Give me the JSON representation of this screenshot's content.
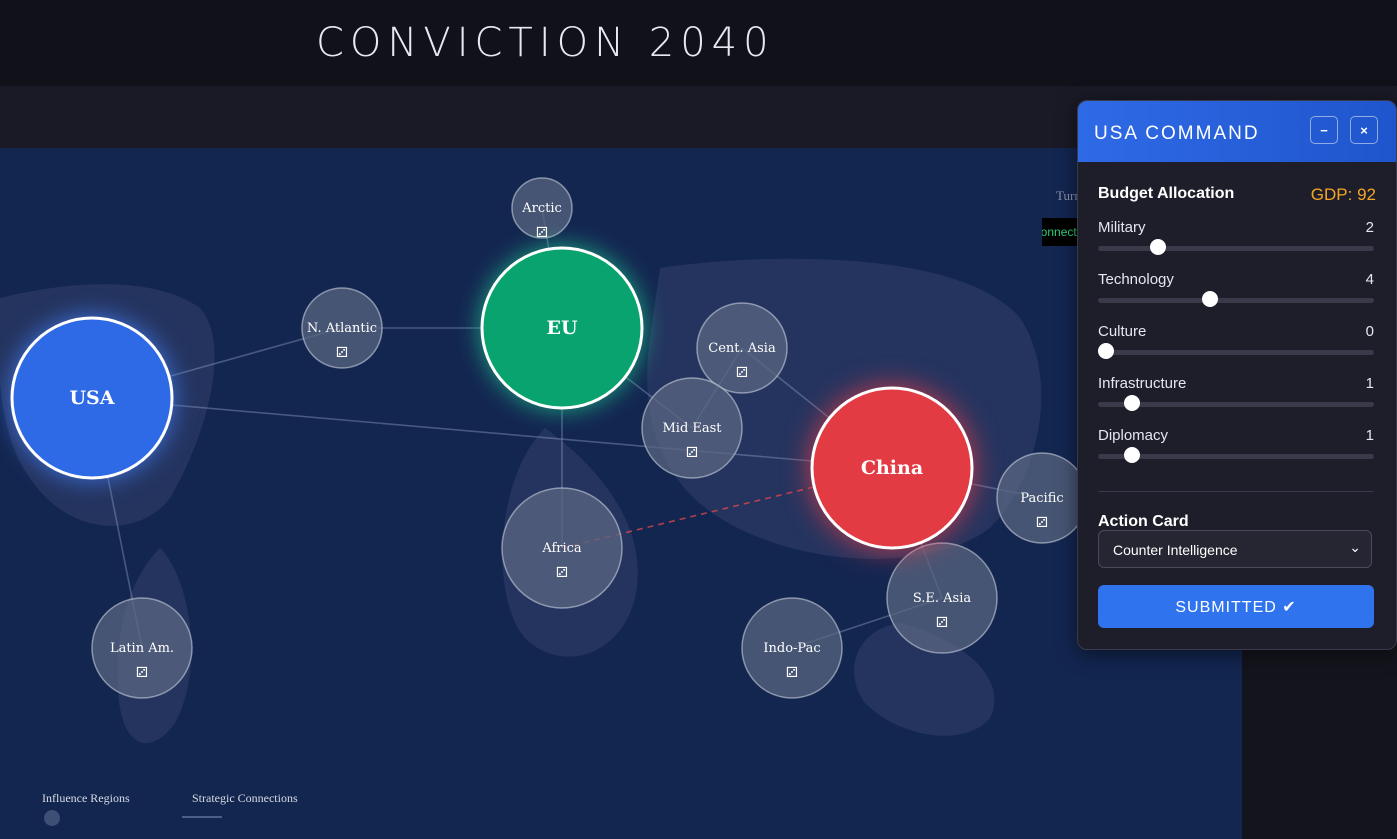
{
  "app": {
    "title": "CONVICTION 2040"
  },
  "map": {
    "turn_label": "Turn",
    "connection_status": "Connected",
    "nodes": [
      {
        "id": "usa",
        "label": "USA",
        "type": "power",
        "color": "#2f6ae6"
      },
      {
        "id": "eu",
        "label": "EU",
        "type": "power",
        "color": "#08a36e"
      },
      {
        "id": "china",
        "label": "China",
        "type": "power",
        "color": "#e23b44"
      },
      {
        "id": "arctic",
        "label": "Arctic",
        "type": "region",
        "icon": "die-icon",
        "glyph": "⚂"
      },
      {
        "id": "natlantic",
        "label": "N. Atlantic",
        "type": "region",
        "icon": "die-icon",
        "glyph": "⚂"
      },
      {
        "id": "centasia",
        "label": "Cent. Asia",
        "type": "region",
        "icon": "die-icon",
        "glyph": "⚂"
      },
      {
        "id": "mideast",
        "label": "Mid East",
        "type": "region",
        "icon": "die-icon",
        "glyph": "⚂"
      },
      {
        "id": "africa",
        "label": "Africa",
        "type": "region",
        "icon": "die-icon",
        "glyph": "⚂"
      },
      {
        "id": "pacific",
        "label": "Pacific",
        "type": "region",
        "icon": "die-icon",
        "glyph": "⚂"
      },
      {
        "id": "seasia",
        "label": "S.E. Asia",
        "type": "region",
        "icon": "die-icon",
        "glyph": "⚂"
      },
      {
        "id": "indopac",
        "label": "Indo-Pac",
        "type": "region",
        "icon": "die-icon",
        "glyph": "⚂"
      },
      {
        "id": "latam",
        "label": "Latin Am.",
        "type": "region",
        "icon": "die-icon",
        "glyph": "⚂"
      }
    ],
    "legend": {
      "influence_regions": "Influence Regions",
      "strategic_connections": "Strategic Connections"
    }
  },
  "panel": {
    "title": "USA COMMAND",
    "minimize_glyph": "−",
    "close_glyph": "×",
    "budget_title": "Budget Allocation",
    "gdp_label": "GDP: 92",
    "sliders": [
      {
        "label": "Military",
        "value": "2",
        "level": 0.2
      },
      {
        "label": "Technology",
        "value": "4",
        "level": 0.4
      },
      {
        "label": "Culture",
        "value": "0",
        "level": 0.0
      },
      {
        "label": "Infrastructure",
        "value": "1",
        "level": 0.1
      },
      {
        "label": "Diplomacy",
        "value": "1",
        "level": 0.1
      }
    ],
    "action_card_title": "Action Card",
    "action_card_selected": "Counter Intelligence",
    "submit_label": "SUBMITTED ✔"
  },
  "colors": {
    "accent": "#2f74ee",
    "gdp": "#f5a524",
    "usa": "#2f6ae6",
    "eu": "#08a36e",
    "china": "#e23b44"
  }
}
